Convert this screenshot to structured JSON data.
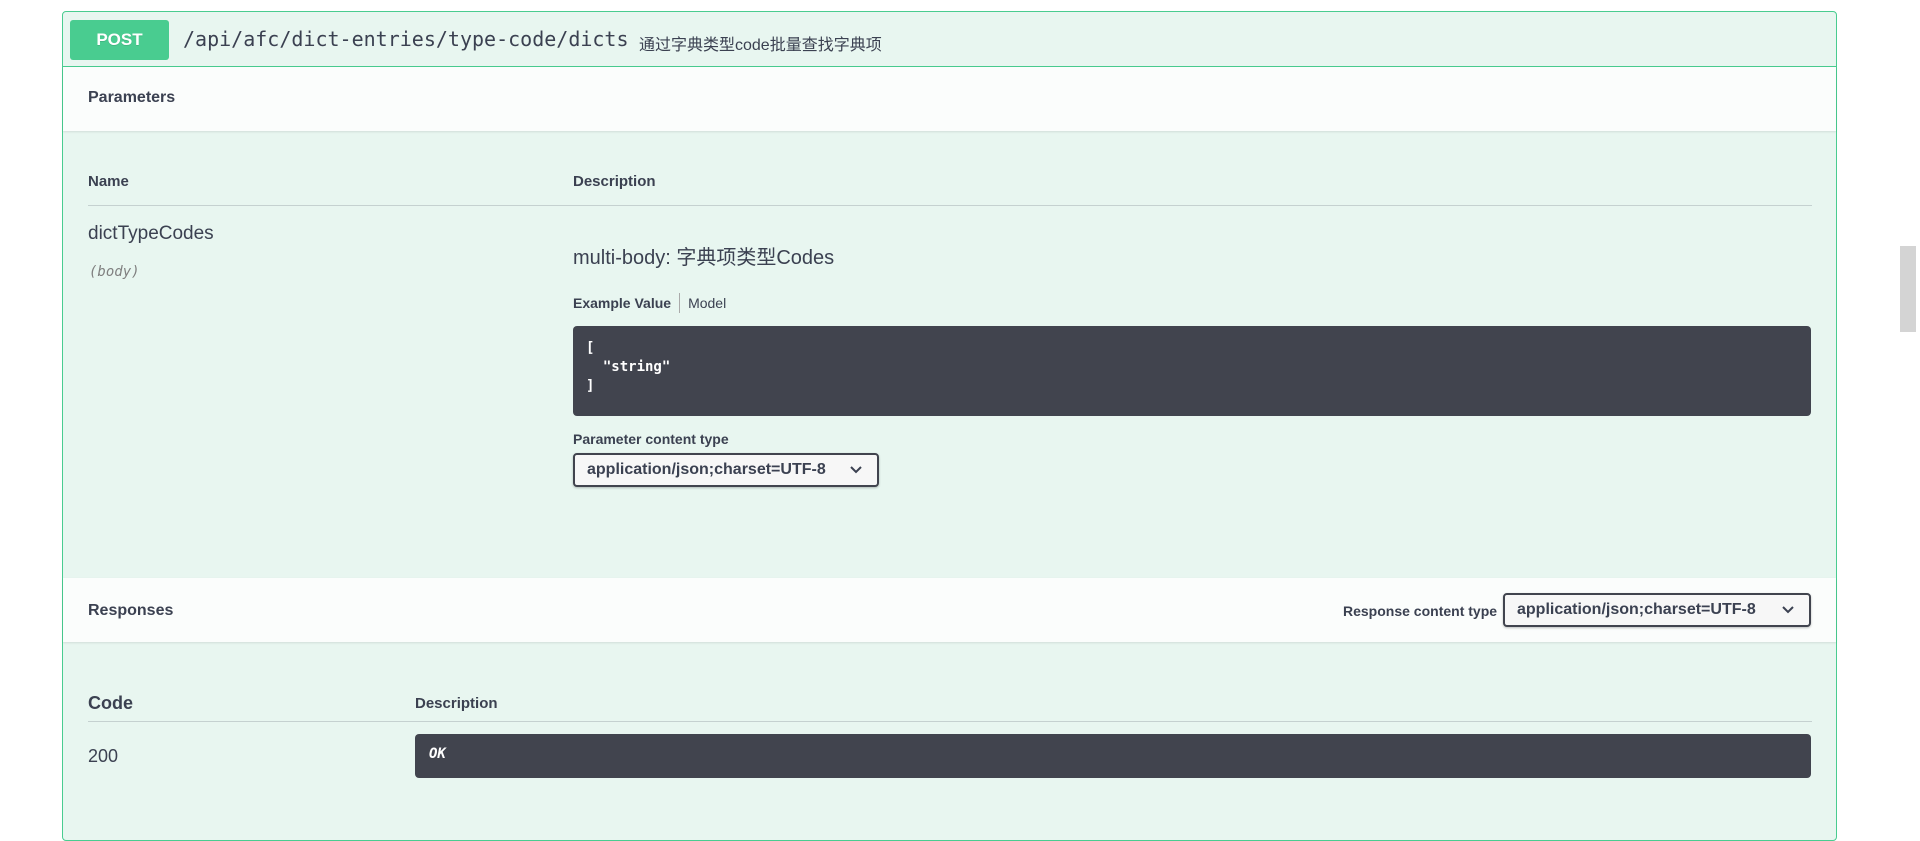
{
  "endpoint": {
    "method": "POST",
    "path": "/api/afc/dict-entries/type-code/dicts",
    "summary": "通过字典类型code批量查找字典项"
  },
  "parameters": {
    "title": "Parameters",
    "col_name": "Name",
    "col_description": "Description",
    "items": [
      {
        "name": "dictTypeCodes",
        "in": "(body)",
        "description": "multi-body: 字典项类型Codes",
        "tab_example": "Example Value",
        "tab_model": "Model",
        "example": "[\n  \"string\"\n]",
        "content_type_label": "Parameter content type",
        "content_type_value": "application/json;charset=UTF-8"
      }
    ]
  },
  "responses": {
    "title": "Responses",
    "content_type_label": "Response content type",
    "content_type_value": "application/json;charset=UTF-8",
    "col_code": "Code",
    "col_description": "Description",
    "rows": [
      {
        "code": "200",
        "description": "OK"
      }
    ]
  },
  "colors": {
    "post": "#49cc90",
    "block_bg": "#e8f6f0",
    "code_bg": "#41444e"
  }
}
